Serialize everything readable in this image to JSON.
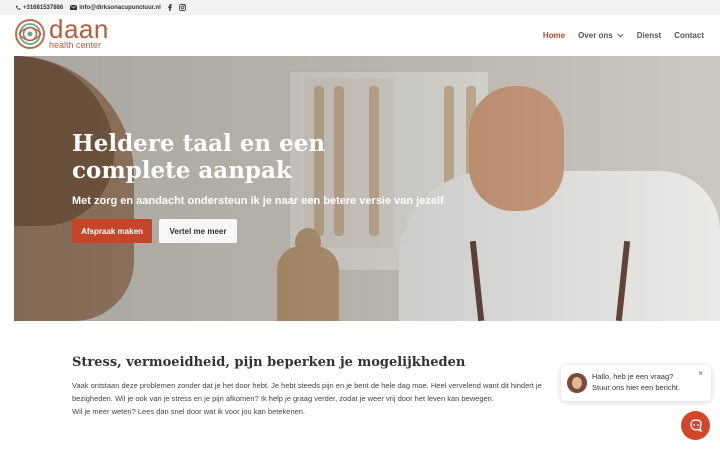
{
  "topbar": {
    "phone": "+31681537886",
    "email": "info@dirksonacupunctuur.nl",
    "icons": [
      "phone-icon",
      "mail-icon",
      "facebook-icon",
      "instagram-icon"
    ]
  },
  "logo": {
    "main": "daan",
    "sub": "health center"
  },
  "nav": {
    "items": [
      {
        "label": "Home",
        "active": true
      },
      {
        "label": "Over ons",
        "has_dropdown": true
      },
      {
        "label": "Dienst"
      },
      {
        "label": "Contact"
      }
    ]
  },
  "hero": {
    "title": "Heldere taal en een complete aanpak",
    "subtitle": "Met zorg en aandacht ondersteun ik je naar een betere versie van jezelf",
    "primary_button": "Afspraak maken",
    "secondary_button": "Vertel me meer"
  },
  "content": {
    "title": "Stress, vermoeidheid, pijn beperken je mogelijkheden",
    "text1": "Vaak ontstaan deze problemen zonder dat je het door hebt. Je hebt steeds pijn en je bent de hele dag moe. Heel vervelend want dit hindert je",
    "text2": "bezigheden. Wil je ook van je stress en je pijn afkomen? Ik help je graag verder, zodat je weer vrij door het leven kan bewegen.",
    "text3": "Wil je meer weten? Lees dan snel door wat ik voor jou kan betekenen."
  },
  "chat": {
    "line1": "Hallo, heb je een vraag?",
    "line2": "Stuur ons hier een bericht.",
    "close": "×"
  },
  "colors": {
    "accent": "#c5452a",
    "logo": "#b35e3f",
    "topbar_bg": "#f3f3f3"
  }
}
